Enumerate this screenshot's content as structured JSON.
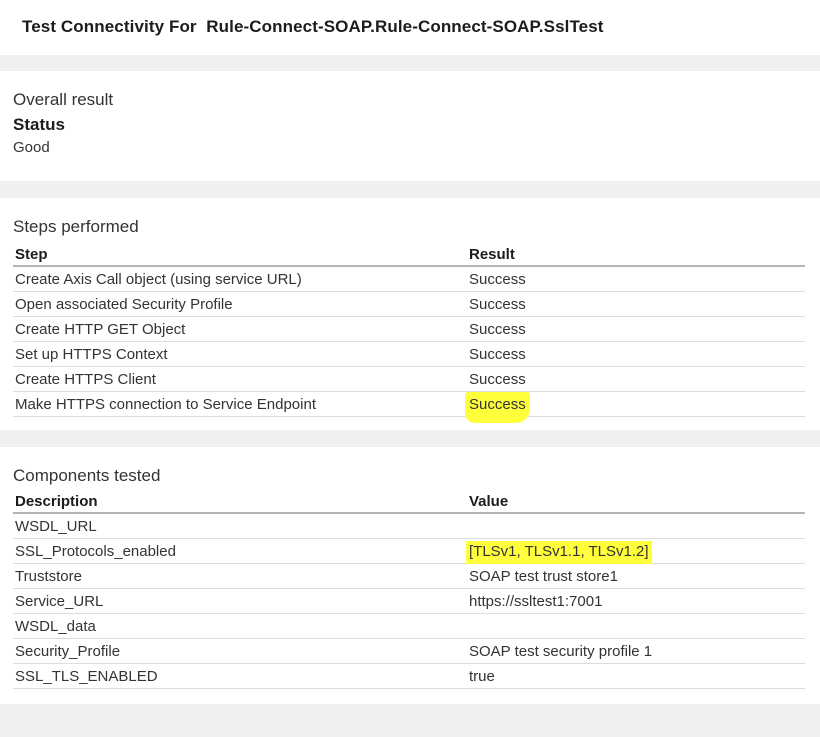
{
  "header": {
    "title": "Test Connectivity For  Rule-Connect-SOAP.Rule-Connect-SOAP.SslTest"
  },
  "overall": {
    "title": "Overall result",
    "status_label": "Status",
    "status_value": "Good"
  },
  "steps": {
    "title": "Steps performed",
    "columns": [
      "Step",
      "Result"
    ],
    "rows": [
      {
        "step": "Create Axis Call object (using service URL)",
        "result": "Success"
      },
      {
        "step": "Open associated Security Profile",
        "result": "Success"
      },
      {
        "step": "Create HTTP GET Object",
        "result": "Success"
      },
      {
        "step": "Set up HTTPS Context",
        "result": "Success"
      },
      {
        "step": "Create HTTPS Client",
        "result": "Success"
      },
      {
        "step": "Make HTTPS connection to Service Endpoint",
        "result": "Success"
      }
    ]
  },
  "components": {
    "title": "Components tested",
    "columns": [
      "Description",
      "Value"
    ],
    "rows": [
      {
        "description": "WSDL_URL",
        "value": ""
      },
      {
        "description": "SSL_Protocols_enabled",
        "value": "[TLSv1, TLSv1.1, TLSv1.2]"
      },
      {
        "description": "Truststore",
        "value": "SOAP test trust store1"
      },
      {
        "description": "Service_URL",
        "value": "https://ssltest1:7001"
      },
      {
        "description": "WSDL_data",
        "value": ""
      },
      {
        "description": "Security_Profile",
        "value": "SOAP test security profile 1"
      },
      {
        "description": "SSL_TLS_ENABLED",
        "value": "true"
      }
    ]
  },
  "colors": {
    "highlight": "#ffff3c",
    "page_background": "#efefef",
    "panel_background": "#ffffff"
  }
}
